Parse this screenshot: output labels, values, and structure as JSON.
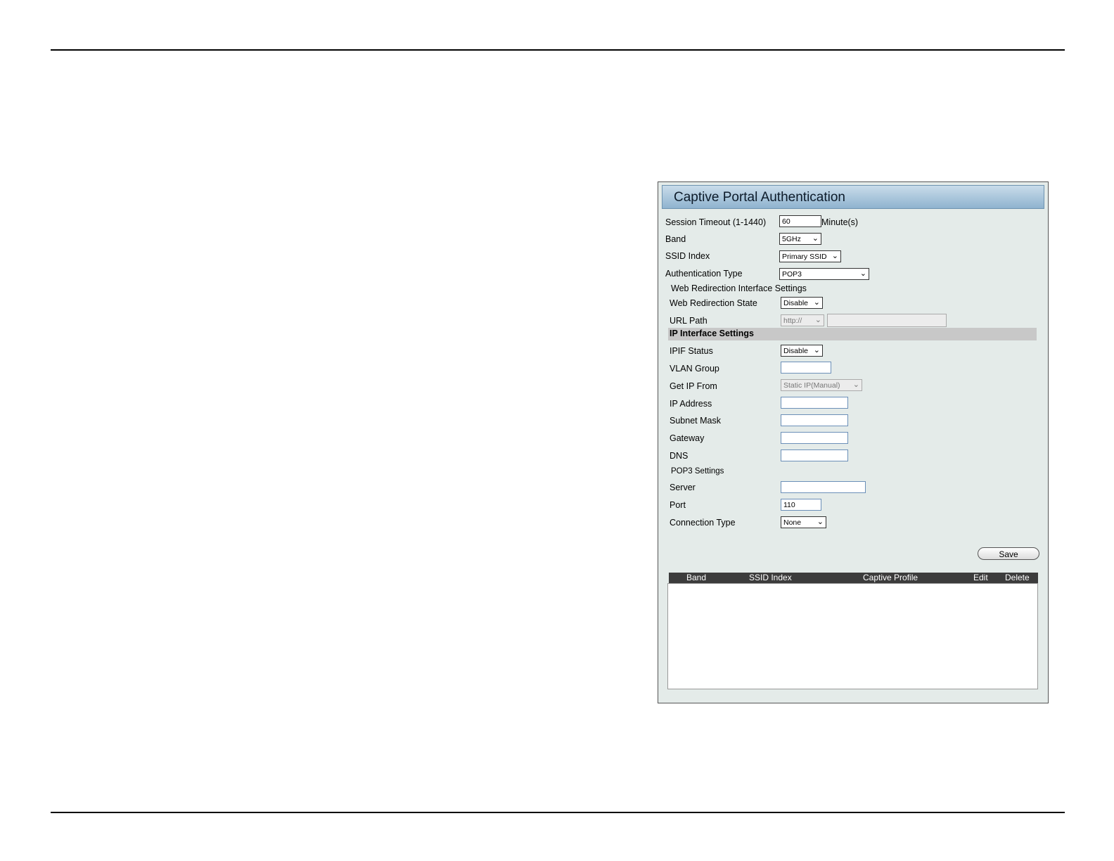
{
  "panel": {
    "title": "Captive Portal Authentication"
  },
  "form": {
    "session_timeout_label": "Session Timeout (1-1440)",
    "session_timeout_value": "60",
    "session_timeout_unit": "Minute(s)",
    "band_label": "Band",
    "band_value": "5GHz",
    "ssid_index_label": "SSID Index",
    "ssid_index_value": "Primary SSID",
    "auth_type_label": "Authentication Type",
    "auth_type_value": "POP3",
    "web_redirection_heading": "Web Redirection Interface Settings",
    "web_redirection_state_label": "Web Redirection State",
    "web_redirection_state_value": "Disable",
    "url_path_label": "URL Path",
    "url_path_scheme": "http://",
    "url_path_value": ""
  },
  "ip_interface": {
    "heading": "IP Interface Settings",
    "ipif_status_label": "IPIF Status",
    "ipif_status_value": "Disable",
    "vlan_group_label": "VLAN Group",
    "vlan_group_value": "",
    "get_ip_from_label": "Get IP From",
    "get_ip_from_value": "Static IP(Manual)",
    "ip_address_label": "IP Address",
    "ip_address_value": "",
    "subnet_mask_label": "Subnet Mask",
    "subnet_mask_value": "",
    "gateway_label": "Gateway",
    "gateway_value": "",
    "dns_label": "DNS",
    "dns_value": ""
  },
  "pop3": {
    "heading": "POP3 Settings",
    "server_label": "Server",
    "server_value": "",
    "port_label": "Port",
    "port_value": "110",
    "connection_type_label": "Connection Type",
    "connection_type_value": "None"
  },
  "actions": {
    "save_label": "Save"
  },
  "table": {
    "columns": [
      "Band",
      "SSID Index",
      "Captive Profile",
      "Edit",
      "Delete"
    ],
    "rows": []
  },
  "icons": {
    "dropdown": "chevron-down-icon"
  }
}
